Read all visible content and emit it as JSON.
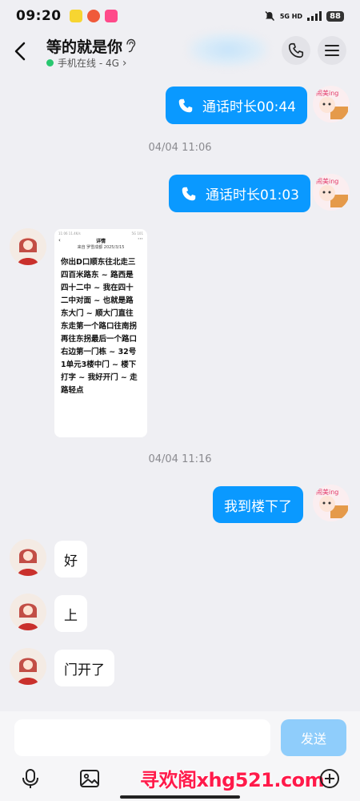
{
  "status_bar": {
    "time": "09:20",
    "network": "5G HD",
    "battery": "88"
  },
  "header": {
    "title": "等的就是你",
    "online_status": "手机在线 - 4G",
    "chevron": "›"
  },
  "messages": [
    {
      "type": "call",
      "direction": "out",
      "text": "通话时长00:44"
    },
    {
      "type": "timestamp",
      "text": "04/04 11:06"
    },
    {
      "type": "call",
      "direction": "out",
      "text": "通话时长01:03"
    },
    {
      "type": "image",
      "direction": "in",
      "image_title": "详情",
      "image_subtitle": "来自 罗雪成都 2025/3/15",
      "image_text": "你出D口顺东往北走三四百米路东 ~ 路西是四十二中 ~ 我在四十二中对面 ~ 也就是路东大门 ~ 顺大门直往东走第一个路口往南拐再往东拐最后一个路口右边第一门栋 ~ 32号1单元3楼中门 ~ 楼下打字 ~ 我好开门 ~ 走路轻点",
      "image_status_left": "11:06 11.4K/s",
      "image_status_right": "5G 101"
    },
    {
      "type": "timestamp",
      "text": "04/04 11:16"
    },
    {
      "type": "text",
      "direction": "out",
      "text": "我到楼下了"
    },
    {
      "type": "text",
      "direction": "in",
      "text": "好"
    },
    {
      "type": "text",
      "direction": "in",
      "text": "上"
    },
    {
      "type": "text",
      "direction": "in",
      "text": "门开了"
    }
  ],
  "input": {
    "value": "",
    "placeholder": "",
    "send_label": "发送"
  },
  "watermark": "寻欢阁xhg521.com",
  "sticker_text": "闹美ing",
  "colors": {
    "outgoing_bubble": "#0a99ff",
    "send_button": "#8fcdfb",
    "online_dot": "#28c76f",
    "watermark": "#ff1a4a"
  },
  "icons": [
    "back-icon",
    "ear-icon",
    "phone-icon",
    "menu-icon",
    "mic-icon",
    "image-icon",
    "plus-icon"
  ]
}
